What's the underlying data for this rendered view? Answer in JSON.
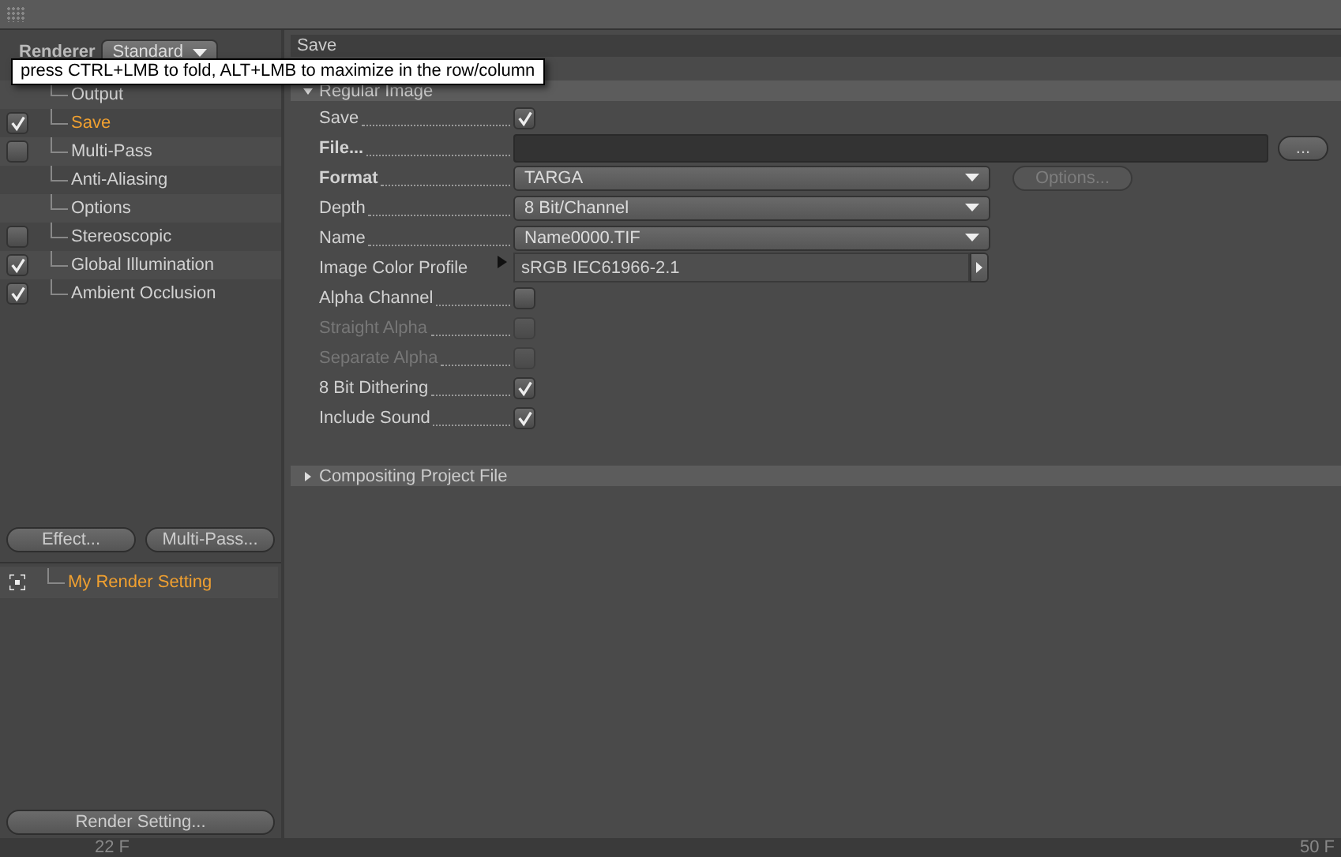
{
  "renderer": {
    "label": "Renderer",
    "value": "Standard"
  },
  "tooltip": "press CTRL+LMB to fold, ALT+LMB to maximize in the row/column",
  "settings_tree": [
    {
      "label": "Output",
      "kind": "plain",
      "selected": false
    },
    {
      "label": "Save",
      "kind": "check",
      "checked": true,
      "selected": true
    },
    {
      "label": "Multi-Pass",
      "kind": "check",
      "checked": false,
      "selected": false
    },
    {
      "label": "Anti-Aliasing",
      "kind": "plain",
      "selected": false
    },
    {
      "label": "Options",
      "kind": "plain",
      "selected": false
    },
    {
      "label": "Stereoscopic",
      "kind": "check",
      "checked": false,
      "selected": false
    },
    {
      "label": "Global Illumination",
      "kind": "check",
      "checked": true,
      "selected": false
    },
    {
      "label": "Ambient Occlusion",
      "kind": "check",
      "checked": true,
      "selected": false
    }
  ],
  "left_buttons": [
    "Effect...",
    "Multi-Pass..."
  ],
  "render_settings_list": [
    {
      "label": "My Render Setting",
      "selected": true
    }
  ],
  "render_setting_button": "Render Setting...",
  "panel": {
    "title": "Save",
    "groups": [
      {
        "title": "Regular Image",
        "expanded": true,
        "rows": [
          {
            "kind": "check",
            "label": "Save",
            "checked": true,
            "disabled": false
          },
          {
            "kind": "file",
            "label": "File...",
            "bold": true,
            "button": "..."
          },
          {
            "kind": "dropdown",
            "label": "Format",
            "bold": true,
            "value": "TARGA",
            "button": {
              "label": "Options...",
              "disabled": true
            }
          },
          {
            "kind": "dropdown",
            "label": "Depth",
            "value": "8 Bit/Channel"
          },
          {
            "kind": "dropdown",
            "label": "Name",
            "value": "Name0000.TIF"
          },
          {
            "kind": "profile",
            "label": "Image Color Profile",
            "value": "sRGB IEC61966-2.1"
          },
          {
            "kind": "check",
            "label": "Alpha Channel",
            "checked": false,
            "disabled": false
          },
          {
            "kind": "check",
            "label": "Straight Alpha",
            "checked": false,
            "disabled": true
          },
          {
            "kind": "check",
            "label": "Separate Alpha",
            "checked": false,
            "disabled": true
          },
          {
            "kind": "check",
            "label": "8 Bit Dithering",
            "checked": true,
            "disabled": false
          },
          {
            "kind": "check",
            "label": "Include Sound",
            "checked": true,
            "disabled": false
          }
        ]
      },
      {
        "title": "Compositing Project File",
        "expanded": false
      }
    ]
  },
  "timeline": {
    "start": "22 F",
    "end": "50 F"
  }
}
